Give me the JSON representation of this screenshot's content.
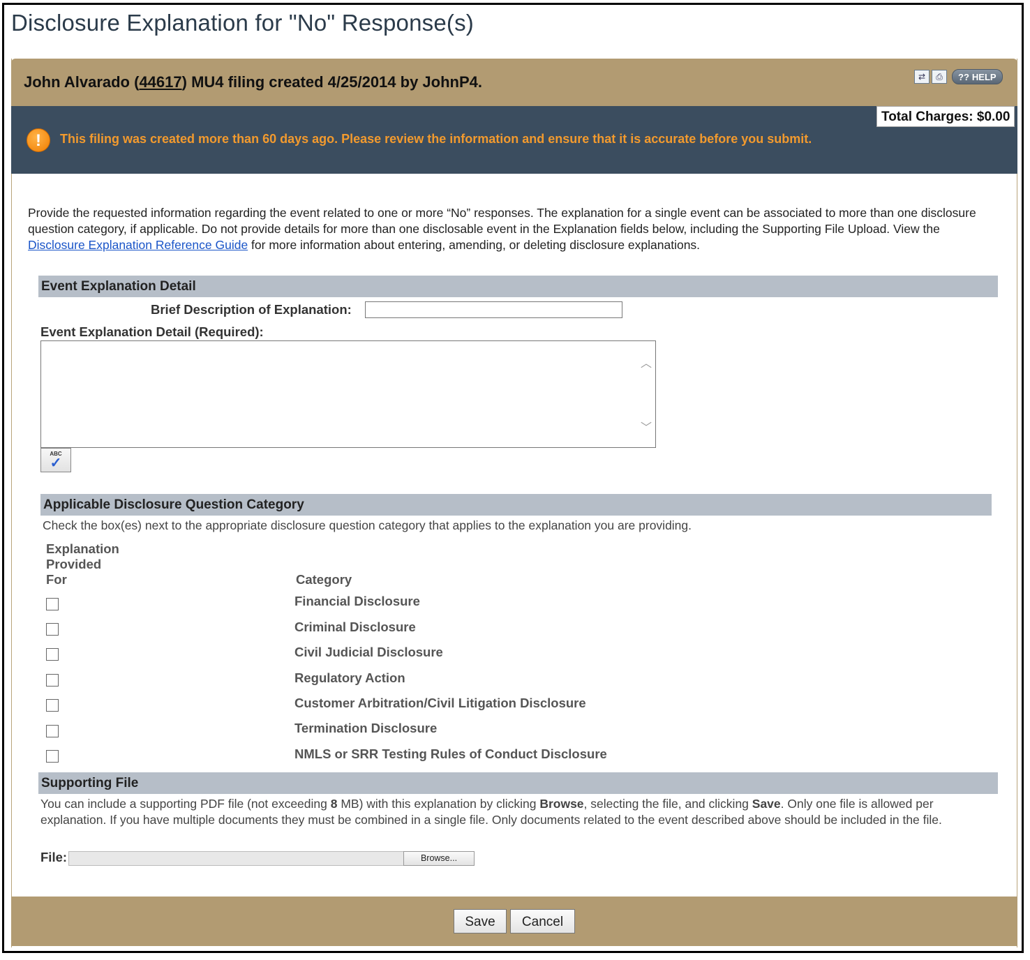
{
  "page": {
    "title": "Disclosure Explanation for \"No\" Response(s)"
  },
  "header": {
    "name_prefix": "John Alvarado (",
    "nmls_id": "44617",
    "name_suffix": ") MU4 filing created 4/25/2014 by JohnP4.",
    "help_label": "HELP",
    "help_icon_text": "??",
    "icons": [
      "compare-icon",
      "print-icon",
      "help-icon"
    ]
  },
  "status": {
    "total_charges": "Total Charges: $0.00",
    "alert_message": "This filing was created more than 60 days ago. Please review the information and ensure that it is accurate before you submit.",
    "alert_icon": "warning-icon",
    "alert_color": "#f29a2e"
  },
  "intro": {
    "text_before_link": "Provide the requested information regarding the event related to one or more “No” responses. The explanation for a single event can be associated to more than one disclosure question category, if applicable. Do not provide details for more than one disclosable event in the Explanation fields below, including the Supporting File Upload. View the ",
    "link_text": "Disclosure Explanation Reference Guide",
    "text_after_link": " for more information about entering, amending, or deleting disclosure explanations."
  },
  "event_section": {
    "title": "Event Explanation Detail",
    "brief_label": "Brief Description of Explanation:",
    "brief_value": "",
    "detail_label": "Event Explanation Detail (Required):",
    "detail_value": "",
    "spellcheck_icon": "spellcheck-icon",
    "spellcheck_abc": "ABC"
  },
  "category_section": {
    "title": "Applicable Disclosure Question Category",
    "instructions": "Check the box(es) next to the appropriate disclosure question category that applies to the explanation you are providing.",
    "col_provided_line1": "Explanation",
    "col_provided_line2": "Provided",
    "col_provided_line3": "For",
    "col_category": "Category",
    "categories": [
      {
        "label": "Financial Disclosure",
        "checked": false
      },
      {
        "label": "Criminal Disclosure",
        "checked": false
      },
      {
        "label": "Civil Judicial Disclosure",
        "checked": false
      },
      {
        "label": "Regulatory Action",
        "checked": false
      },
      {
        "label": "Customer Arbitration/Civil Litigation Disclosure",
        "checked": false
      },
      {
        "label": "Termination Disclosure",
        "checked": false
      },
      {
        "label": "NMLS or SRR Testing Rules of Conduct Disclosure",
        "checked": false
      }
    ]
  },
  "supporting_section": {
    "title": "Supporting File",
    "text_1": "You can include a supporting PDF file (not exceeding ",
    "text_size": "8",
    "text_2": " MB) with this explanation by clicking ",
    "text_browse": "Browse",
    "text_3": ", selecting the file, and clicking ",
    "text_save": "Save",
    "text_4": ". Only one file is allowed per explanation. If you have multiple documents they must be combined in a single file. Only documents related to the event described above should be included in the file.",
    "file_label": "File:",
    "file_value": "",
    "browse_label": "Browse..."
  },
  "footer": {
    "save_label": "Save",
    "cancel_label": "Cancel"
  },
  "colors": {
    "header_bar": "#b29b72",
    "alert_bar": "#3b4d5f",
    "section_bar": "#b6bec8",
    "link": "#1a55c8"
  }
}
